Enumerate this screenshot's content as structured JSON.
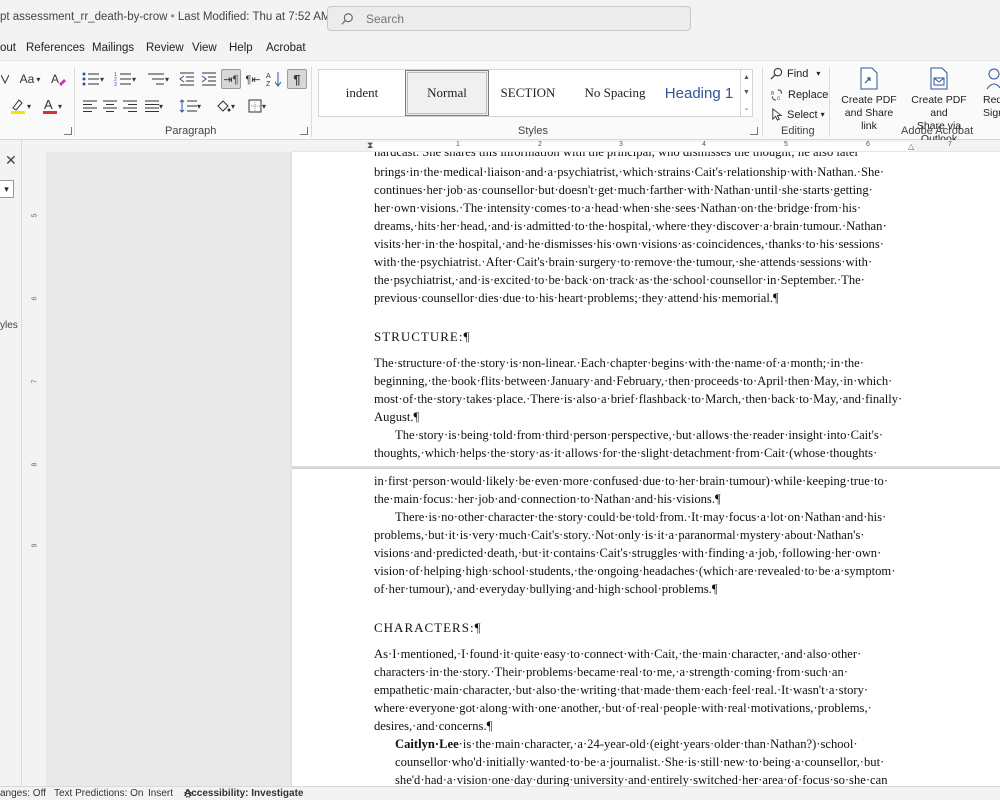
{
  "titlebar": {
    "doc_title": "pt assessment_rr_death-by-crow",
    "separator": "•",
    "modified": "Last Modified: Thu at 7:52 AM",
    "search_placeholder": "Search"
  },
  "menu": {
    "items": [
      "out",
      "References",
      "Mailings",
      "Review",
      "View",
      "Help",
      "Acrobat"
    ]
  },
  "ribbon": {
    "font_group": {
      "case_label": "Aa"
    },
    "paragraph_label": "Paragraph",
    "styles_label": "Styles",
    "styles": [
      "indent",
      "Normal",
      "SECTION",
      "No Spacing",
      "Heading 1"
    ],
    "active_style": "Normal",
    "editing": {
      "label": "Editing",
      "find": "Find",
      "replace": "Replace",
      "select": "Select"
    },
    "acrobat": {
      "label": "Adobe Acrobat",
      "create_share_1": "Create PDF",
      "create_share_2": "and Share link",
      "create_outlook_1": "Create PDF and",
      "create_outlook_2": "Share via Outlook",
      "request_1": "Req",
      "request_2": "Signa"
    },
    "colors": {
      "highlight": "#f5e600",
      "font": "#d13438"
    }
  },
  "sidebar": {
    "close": "✕",
    "label": "yles"
  },
  "ruler": {
    "h_numbers": [
      "1",
      "2",
      "3",
      "4",
      "5",
      "6",
      "7"
    ],
    "v_numbers": [
      "5",
      "6",
      "7",
      "8",
      "9"
    ]
  },
  "document": {
    "page1": {
      "cut_top_line": "hardcast. She shares this information with the principal, who dismisses the thought; he also later",
      "para1": "brings·in·the·medical·liaison·and·a·psychiatrist,·which·strains·Cait's·relationship·with·Nathan.·She· continues·her·job·as·counsellor·but·doesn't·get·much·farther·with·Nathan·until·she·starts·getting· her·own·visions.·The·intensity·comes·to·a·head·when·she·sees·Nathan·on·the·bridge·from·his· dreams,·hits·her·head,·and·is·admitted·to·the·hospital,·where·they·discover·a·brain·tumour.·Nathan· visits·her·in·the·hospital,·and·he·dismisses·his·own·visions·as·coincidences,·thanks·to·his·sessions· with·the·psychiatrist.·After·Cait's·brain·surgery·to·remove·the·tumour,·she·attends·sessions·with· the·psychiatrist,·and·is·excited·to·be·back·on·track·as·the·school·counsellor·in·September.·The· previous·counsellor·dies·due·to·his·heart·problems;·they·attend·his·memorial.¶",
      "structure_heading": "STRUCTURE:¶",
      "para2": "The·structure·of·the·story·is·non-linear.·Each·chapter·begins·with·the·name·of·a·month;·in·the· beginning,·the·book·flits·between·January·and·February,·then·proceeds·to·April·then·May,·in·which· most·of·the·story·takes·place.·There·is·also·a·brief·flashback·to·March,·then·back·to·May,·and·finally· August.¶",
      "para3": "The·story·is·being·told·from·third·person·perspective,·but·allows·the·reader·insight·into·Cait's· thoughts,·which·helps·the·story·as·it·allows·for·the·slight·detachment·from·Cait·(whose·thoughts·"
    },
    "page2": {
      "para3_cont": "in·first·person·would·likely·be·even·more·confused·due·to·her·brain·tumour)·while·keeping·true·to· the·main·focus:·her·job·and·connection·to·Nathan·and·his·visions.¶",
      "para4": "There·is·no·other·character·the·story·could·be·told·from.·It·may·focus·a·lot·on·Nathan·and·his· problems,·but·it·is·very·much·Cait's·story.·Not·only·is·it·a·paranormal·mystery·about·Nathan's· visions·and·predicted·death,·but·it·contains·Cait's·struggles·with·finding·a·job,·following·her·own· vision·of·helping·high·school·students,·the·ongoing·headaches·(which·are·revealed·to·be·a·symptom· of·her·tumour),·and·everyday·bullying·and·high·school·problems.¶",
      "characters_heading": "CHARACTERS:¶",
      "para5": "As·I·mentioned,·I·found·it·quite·easy·to·connect·with·Cait,·the·main·character,·and·also·other· characters·in·the·story.·Their·problems·became·real·to·me,·a·strength·coming·from·such·an· empathetic·main·character,·but·also·the·writing·that·made·them·each·feel·real.·It·wasn't·a·story· where·everyone·got·along·with·one·another,·but·of·real·people·with·real·motivations,·problems,· desires,·and·concerns.¶",
      "para6_name": "Caitlyn·Lee",
      "para6": "·is·the·main·character,·a·24-year-old·(eight·years·older·than·Nathan?)·school· counsellor·who'd·initially·wanted·to·be·a·journalist.·She·is·still·new·to·being·a·counsellor,·but· she'd·had·a·vision·one·day·during·university·and·entirely·switched·her·area·of·focus·so·she·can"
    }
  },
  "statusbar": {
    "track_changes": "anges: Off",
    "text_predictions": "Text Predictions: On",
    "insert": "Insert",
    "accessibility": "Accessibility: Investigate"
  }
}
